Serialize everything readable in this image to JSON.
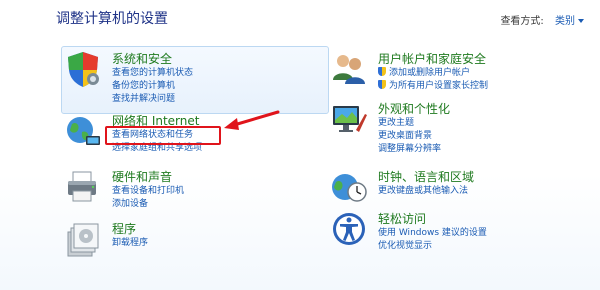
{
  "header": {
    "title": "调整计算机的设置",
    "view_by_label": "查看方式:",
    "view_by_value": "类别"
  },
  "left": [
    {
      "title": "系统和安全",
      "links": [
        "查看您的计算机状态",
        "备份您的计算机",
        "查找并解决问题"
      ]
    },
    {
      "title": "网络和 Internet",
      "links": [
        "查看网络状态和任务",
        "选择家庭组和共享选项"
      ]
    },
    {
      "title": "硬件和声音",
      "links": [
        "查看设备和打印机",
        "添加设备"
      ]
    },
    {
      "title": "程序",
      "links": [
        "卸载程序"
      ]
    }
  ],
  "right": [
    {
      "title": "用户帐户和家庭安全",
      "links": [
        "添加或删除用户帐户",
        "为所有用户设置家长控制"
      ]
    },
    {
      "title": "外观和个性化",
      "links": [
        "更改主题",
        "更改桌面背景",
        "调整屏幕分辨率"
      ]
    },
    {
      "title": "时钟、语言和区域",
      "links": [
        "更改键盘或其他输入法"
      ]
    },
    {
      "title": "轻松访问",
      "links": [
        "使用 Windows 建议的设置",
        "优化视觉显示"
      ]
    }
  ],
  "colors": {
    "accent_red": "#e0141b",
    "heading_green": "#1f7a1f",
    "link_blue": "#1a5bb3"
  }
}
